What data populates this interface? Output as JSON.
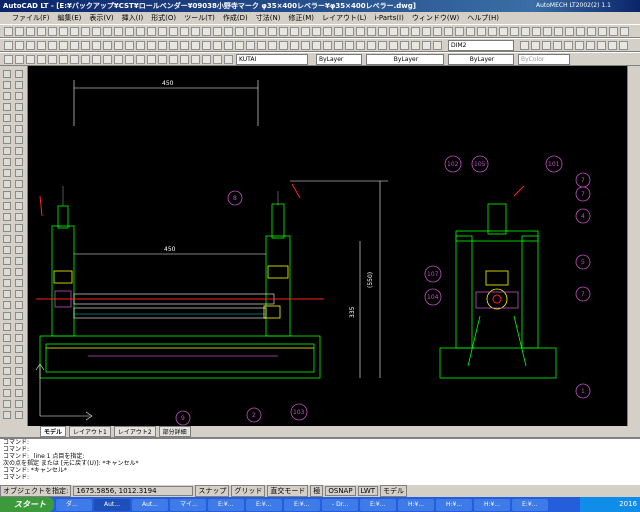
{
  "title": "AutoCAD LT - [E:¥バックアップ¥CST¥ロールベンダー¥09038小野寺マーク φ35×400レベラー¥φ35×400レベラー.dwg]",
  "title2": "AutoMECH LT2002(2) 1.1",
  "menu": [
    "ファイル(F)",
    "編集(E)",
    "表示(V)",
    "挿入(I)",
    "形式(O)",
    "ツール(T)",
    "作成(D)",
    "寸法(N)",
    "修正(M)",
    "レイアウト(L)",
    "i-Parts(I)",
    "ウィンドウ(W)",
    "ヘルプ(H)"
  ],
  "toolbar": {
    "dimstyle": "DIM2",
    "layer": "KUTAI",
    "color": "ByLayer",
    "linetype": "ByLayer",
    "lineweight": "ByLayer",
    "plotstyle": "ByColor"
  },
  "drawing": {
    "dims": [
      "450",
      "450",
      "(550)",
      "335"
    ],
    "balloons": [
      "8",
      "9",
      "2",
      "103",
      "102",
      "105",
      "101",
      "7",
      "7",
      "4",
      "107",
      "5",
      "104",
      "7",
      "1"
    ]
  },
  "tabs": [
    "モデル",
    "レイアウト1",
    "レイアウト2",
    "部分詳細"
  ],
  "command_lines": [
    "コマンド:",
    "コマンド:",
    "コマンド: _line 1 点目を指定:",
    "次の点を指定 または [元に戻す(U)]: *キャンセル*",
    "コマンド: *キャンセル*",
    "コマンド:"
  ],
  "status": {
    "prompt": "オブジェクトを指定:",
    "coords": "1675.5856, 1012.3194",
    "toggles": [
      "スナップ",
      "グリッド",
      "直交モード",
      "極",
      "OSNAP",
      "LWT",
      "モデル"
    ]
  },
  "taskbar": {
    "start": "スタート",
    "tasks": [
      "ダ...",
      "Aut...",
      "Aut...",
      "マイ...",
      "E:¥...",
      "E:¥...",
      "E:¥...",
      "- Dr...",
      "E:¥...",
      "H:¥...",
      "H:¥...",
      "H:¥...",
      "E:¥..."
    ],
    "clock": "2016"
  },
  "colors": {
    "canvas": "#000000",
    "outline": "#00ff00",
    "balloon": "#c050c0",
    "dimension": "#ffffff",
    "title": "#0a246a"
  }
}
